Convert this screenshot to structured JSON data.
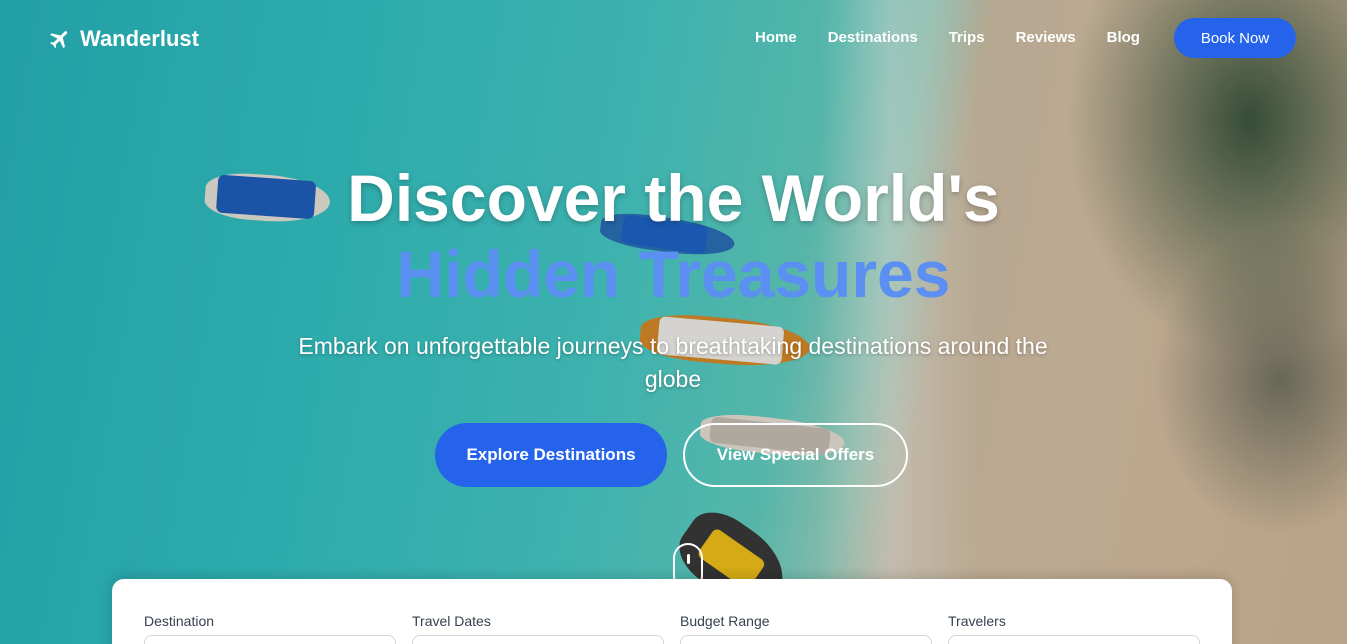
{
  "brand": {
    "name": "Wanderlust",
    "icon": "plane-icon"
  },
  "nav": {
    "links": [
      "Home",
      "Destinations",
      "Trips",
      "Reviews",
      "Blog"
    ],
    "cta": "Book Now"
  },
  "hero": {
    "title_line1": "Discover the World's",
    "title_line2": "Hidden Treasures",
    "subtitle": "Embark on unforgettable journeys to breathtaking destinations around the globe",
    "primary_button": "Explore Destinations",
    "secondary_button": "View Special Offers"
  },
  "search": {
    "fields": [
      {
        "label": "Destination"
      },
      {
        "label": "Travel Dates"
      },
      {
        "label": "Budget Range"
      },
      {
        "label": "Travelers"
      }
    ]
  },
  "colors": {
    "accent": "#2563eb",
    "title_accent": "#5b8ff1",
    "text_light": "#ffffff"
  }
}
